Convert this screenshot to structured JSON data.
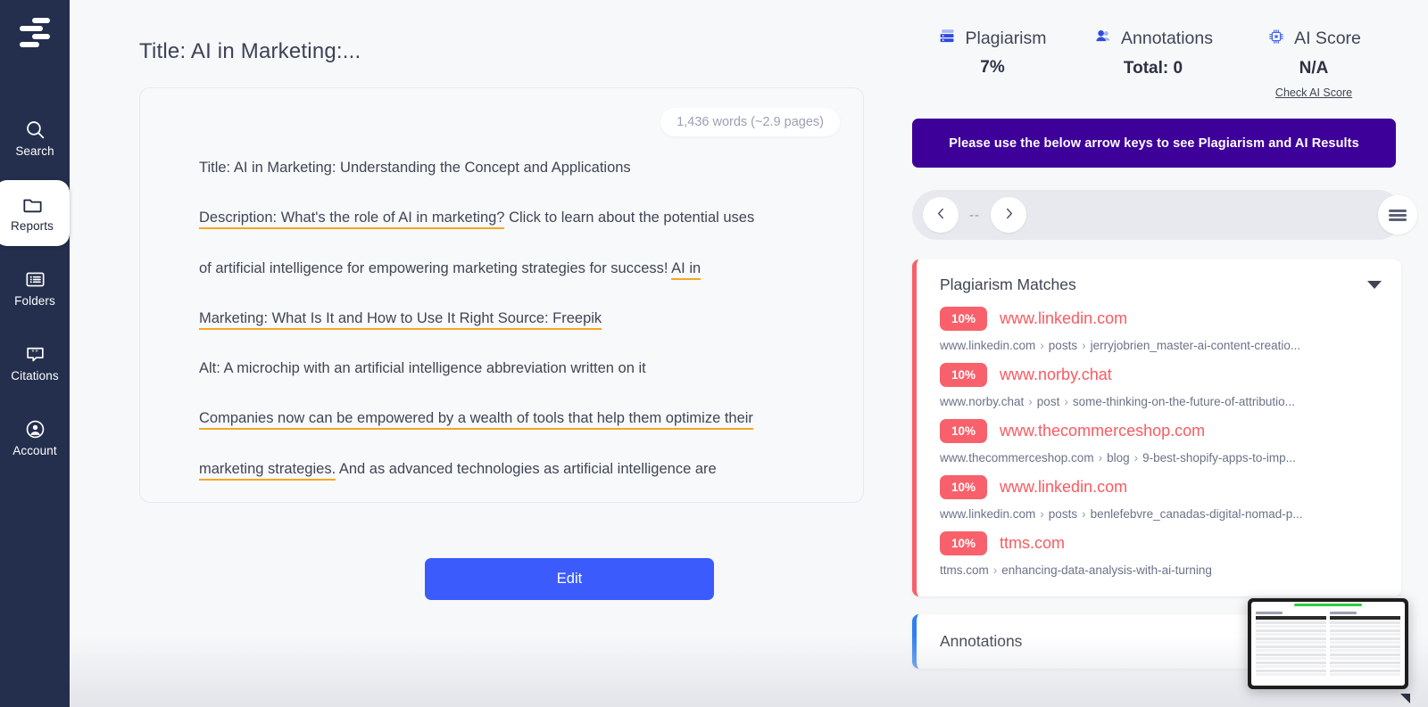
{
  "sidebar": {
    "logo_name": "app-logo",
    "items": [
      {
        "label": "Search",
        "icon": "search-icon",
        "active": false
      },
      {
        "label": "Reports",
        "icon": "folder-icon",
        "active": true
      },
      {
        "label": "Folders",
        "icon": "list-icon",
        "active": false
      },
      {
        "label": "Citations",
        "icon": "quote-icon",
        "active": false
      },
      {
        "label": "Account",
        "icon": "user-circle-icon",
        "active": false
      }
    ]
  },
  "document": {
    "title": "Title: AI in Marketing:...",
    "word_count": "1,436 words (~2.9 pages)",
    "lines": [
      {
        "text": "Title: AI in Marketing: Understanding the Concept and Applications",
        "highlight": "none"
      },
      {
        "text": "Description: What's the role of AI in marketing? Click to learn about the potential uses",
        "highlight": "partial-start",
        "highlight_text": "Description: What's the role of AI in marketing?",
        "rest_text": " Click to learn about the potential uses"
      },
      {
        "text": "of artificial intelligence for empowering marketing strategies for success! AI in",
        "highlight": "partial-end",
        "plain_text": "of artificial intelligence for empowering marketing strategies for success! ",
        "highlight_text": "AI in"
      },
      {
        "text": "Marketing: What Is It and How to Use It Right Source: Freepik",
        "highlight": "full"
      },
      {
        "text": "Alt: A microchip with an artificial intelligence abbreviation written on it",
        "highlight": "none"
      },
      {
        "text": "Companies now can be empowered by a wealth of tools that help them optimize their",
        "highlight": "full"
      },
      {
        "text": "marketing strategies. And as advanced technologies as artificial intelligence are",
        "highlight": "partial-start",
        "highlight_text": "marketing strategies.",
        "rest_text": " And as advanced technologies as artificial intelligence are"
      }
    ],
    "edit_button": "Edit"
  },
  "metrics": [
    {
      "name": "Plagiarism",
      "value": "7%",
      "icon": "plagiarism-stack-icon",
      "link": ""
    },
    {
      "name": "Annotations",
      "value": "Total: 0",
      "icon": "people-icon",
      "link": ""
    },
    {
      "name": "AI Score",
      "value": "N/A",
      "icon": "ai-chip-icon",
      "link": "Check AI Score"
    }
  ],
  "banner": {
    "text": "Please use the below arrow keys to see Plagiarism and AI Results",
    "bg_color": "#3d0099"
  },
  "navbar": {
    "prev_icon": "chevron-left-icon",
    "next_icon": "chevron-right-icon",
    "counter": "--",
    "menu_icon": "hamburger-icon"
  },
  "results": {
    "plagiarism_section": {
      "title": "Plagiarism Matches",
      "accent_color": "#f8616b",
      "collapse_icon": "chevron-down-icon",
      "matches": [
        {
          "percent": "10%",
          "domain": "www.linkedin.com",
          "path_root": "www.linkedin.com",
          "path_mid": "posts",
          "path_leaf": "jerryjobrien_master-ai-content-creatio..."
        },
        {
          "percent": "10%",
          "domain": "www.norby.chat",
          "path_root": "www.norby.chat",
          "path_mid": "post",
          "path_leaf": "some-thinking-on-the-future-of-attributio..."
        },
        {
          "percent": "10%",
          "domain": "www.thecommerceshop.com",
          "path_root": "www.thecommerceshop.com",
          "path_mid": "blog",
          "path_leaf": "9-best-shopify-apps-to-imp..."
        },
        {
          "percent": "10%",
          "domain": "www.linkedin.com",
          "path_root": "www.linkedin.com",
          "path_mid": "posts",
          "path_leaf": "benlefebvre_canadas-digital-nomad-p..."
        },
        {
          "percent": "10%",
          "domain": "ttms.com",
          "path_root": "ttms.com",
          "path_mid": "enhancing-data-analysis-with-ai-turning",
          "path_leaf": ""
        }
      ]
    },
    "annotations_section": {
      "title": "Annotations",
      "accent_color": "#2f7ff0"
    }
  },
  "thumbnail": {
    "name": "floating-preview-thumbnail"
  },
  "colors": {
    "sidebar_bg": "#242f4d",
    "page_bg": "#f7f8fa",
    "primary_button": "#3b5bfd",
    "highlight_underline": "#f5a623",
    "plagiarism_red": "#f8616b",
    "banner_purple": "#3d0099",
    "annotation_blue": "#2f7ff0"
  }
}
